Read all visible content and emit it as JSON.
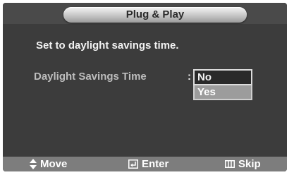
{
  "menu": {
    "title": "Plug & Play",
    "subtitle": "Set to daylight savings time.",
    "setting_label": "Daylight Savings Time",
    "separator": ":",
    "options": [
      {
        "label": "No",
        "selected": true
      },
      {
        "label": "Yes",
        "selected": false
      }
    ]
  },
  "footer": {
    "move": {
      "icon": "up-down-arrows-icon",
      "label": "Move"
    },
    "enter": {
      "icon": "enter-icon",
      "label": "Enter"
    },
    "skip": {
      "icon": "skip-icon",
      "label": "Skip"
    }
  },
  "colors": {
    "panel": "#3c3c3c",
    "footer": "#7d7d7d",
    "highlight": "#9c9c9c"
  }
}
